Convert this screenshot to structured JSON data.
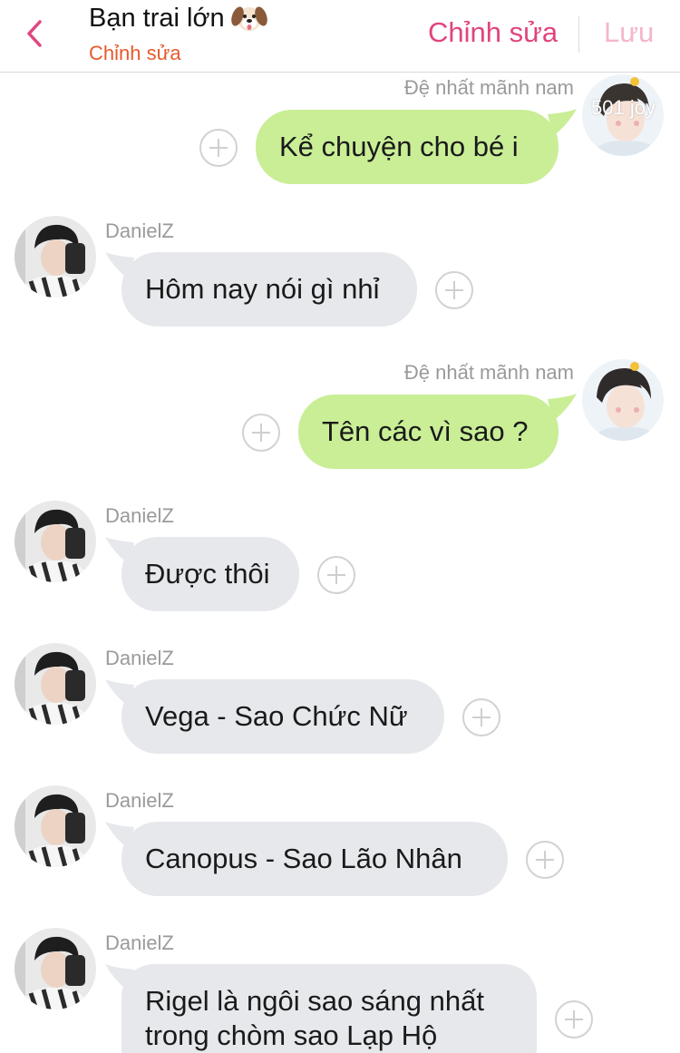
{
  "header": {
    "back_icon": "chevron-left-icon",
    "title": "Bạn trai lớn",
    "title_emoji": "dog-face-emoji",
    "subtitle": "Chỉnh sửa",
    "edit_label": "Chỉnh sửa",
    "save_label": "Lưu",
    "accent_color": "#e0457f",
    "disabled_color": "#f5b5cc"
  },
  "watermark": "501 joy",
  "messages": [
    {
      "side": "right",
      "sender": "Đệ nhất mãnh nam",
      "text": "Kể chuyện cho bé i",
      "color": "#c9ee96"
    },
    {
      "side": "left",
      "sender": "DanielZ",
      "text": "Hôm nay nói gì nhỉ",
      "color": "#e6e8ec"
    },
    {
      "side": "right",
      "sender": "Đệ nhất mãnh nam",
      "text": "Tên các vì sao ?",
      "color": "#c9ee96"
    },
    {
      "side": "left",
      "sender": "DanielZ",
      "text": "Được thôi",
      "color": "#e6e8ec"
    },
    {
      "side": "left",
      "sender": "DanielZ",
      "text": "Vega - Sao Chức Nữ",
      "color": "#e6e8ec"
    },
    {
      "side": "left",
      "sender": "DanielZ",
      "text": "Canopus - Sao Lão Nhân",
      "color": "#e6e8ec"
    },
    {
      "side": "left",
      "sender": "DanielZ",
      "text": "Rigel là ngôi sao sáng nhất trong chòm sao Lạp Hộ",
      "color": "#e6e8ec"
    }
  ]
}
